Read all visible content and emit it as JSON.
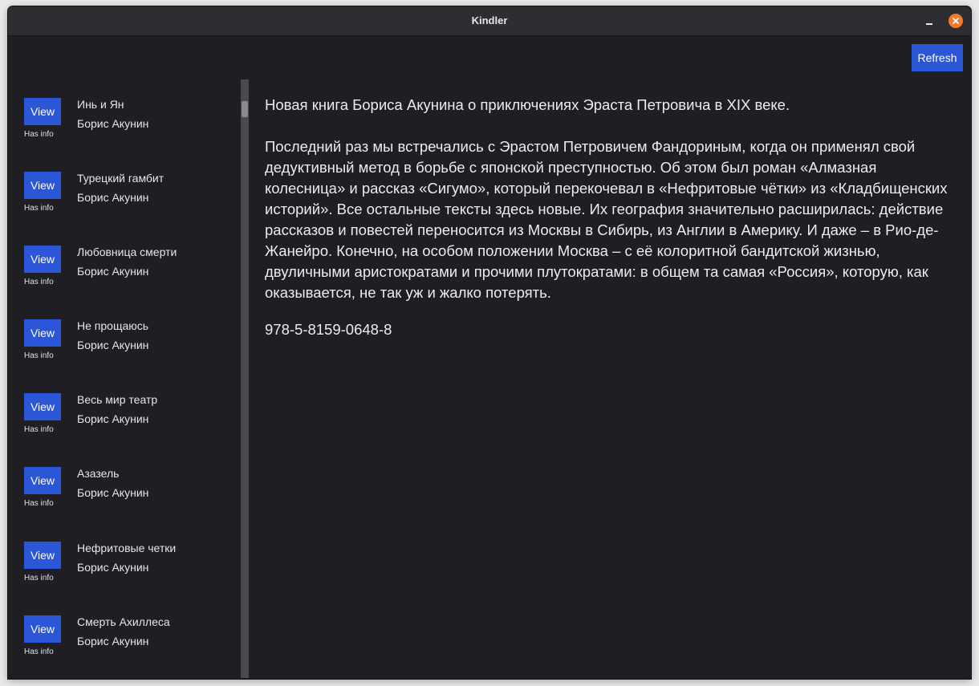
{
  "window": {
    "title": "Kindler"
  },
  "toolbar": {
    "refresh_label": "Refresh"
  },
  "books": [
    {
      "view_label": "View",
      "status": "Has info",
      "title": "Инь и Ян",
      "author": "Борис Акунин"
    },
    {
      "view_label": "View",
      "status": "Has info",
      "title": "Турецкий гамбит",
      "author": "Борис Акунин"
    },
    {
      "view_label": "View",
      "status": "Has info",
      "title": "Любовница смерти",
      "author": "Борис Акунин"
    },
    {
      "view_label": "View",
      "status": "Has info",
      "title": "Не прощаюсь",
      "author": "Борис Акунин"
    },
    {
      "view_label": "View",
      "status": "Has info",
      "title": "Весь мир театр",
      "author": "Борис Акунин"
    },
    {
      "view_label": "View",
      "status": "Has info",
      "title": "Азазель",
      "author": "Борис Акунин"
    },
    {
      "view_label": "View",
      "status": "Has info",
      "title": "Нефритовые четки",
      "author": "Борис Акунин"
    },
    {
      "view_label": "View",
      "status": "Has info",
      "title": "Смерть Ахиллеса",
      "author": "Борис Акунин"
    }
  ],
  "details": {
    "summary": "Новая книга Бориса Акунина о приключениях Эраста Петровича в XIX веке.",
    "body": "Последний раз мы встречались с Эрастом Петровичем Фандориным, когда он применял свой дедуктивный метод в борьбе с японской преступностью. Об этом был роман «Алмазная колесница» и рассказ «Сигумо», который перекочевал в «Нефритовые чётки» из «Кладбищенских историй». Все остальные тексты здесь новые. Их география значительно расширилась: действие рассказов и повестей переносится из Москвы в Сибирь, из Англии в Америку. И даже – в Рио-де-Жанейро. Конечно, на особом положении Москва – с её колоритной бандитской жизнью, двуличными аристократами и прочими плутократами: в общем та самая «Россия», которую, как оказывается, не так уж и жалко потерять.",
    "isbn": "978-5-8159-0648-8"
  },
  "colors": {
    "accent": "#2c56d8",
    "background": "#1f1f23",
    "close": "#f07b28"
  }
}
